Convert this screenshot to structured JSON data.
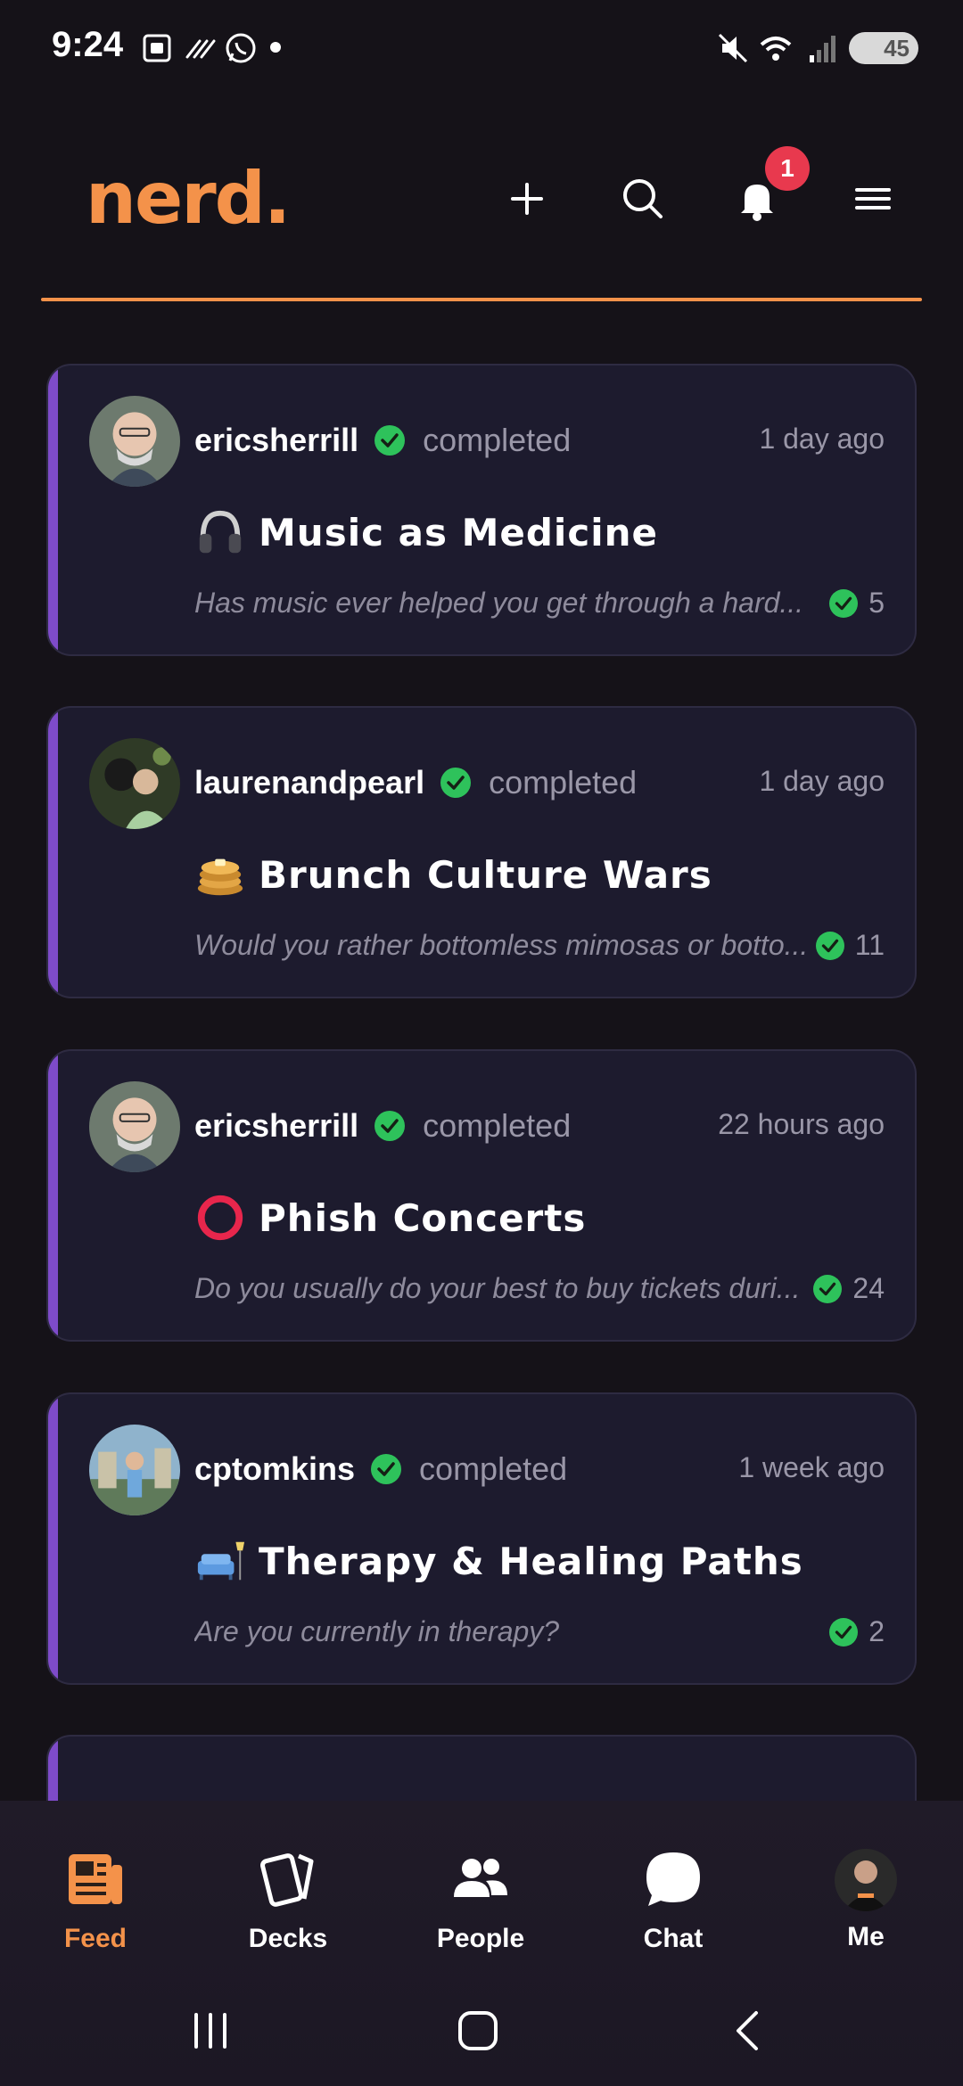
{
  "status_bar": {
    "time": "9:24",
    "battery": "45"
  },
  "header": {
    "logo": "nerd.",
    "notification_count": "1"
  },
  "feed": [
    {
      "user": "ericsherrill",
      "status": "completed",
      "time_ago": "1 day ago",
      "emoji": "headphones-icon",
      "title": "Music as Medicine",
      "desc": "Has music ever helped you get through a hard...",
      "count": "5"
    },
    {
      "user": "laurenandpearl",
      "status": "completed",
      "time_ago": "1 day ago",
      "emoji": "pancakes-icon",
      "title": "Brunch Culture Wars",
      "desc": "Would you rather bottomless mimosas or botto...",
      "count": "11"
    },
    {
      "user": "ericsherrill",
      "status": "completed",
      "time_ago": "22 hours ago",
      "emoji": "red-ring-icon",
      "title": "Phish Concerts",
      "desc": "Do you usually do your best to buy tickets duri...",
      "count": "24"
    },
    {
      "user": "cptomkins",
      "status": "completed",
      "time_ago": "1 week ago",
      "emoji": "couch-lamp-icon",
      "title": "Therapy & Healing Paths",
      "desc": "Are you currently in therapy?",
      "count": "2"
    }
  ],
  "nav": [
    {
      "label": "Feed",
      "icon": "feed-icon",
      "active": true
    },
    {
      "label": "Decks",
      "icon": "decks-icon"
    },
    {
      "label": "People",
      "icon": "people-icon"
    },
    {
      "label": "Chat",
      "icon": "chat-icon"
    },
    {
      "label": "Me",
      "icon": "avatar"
    }
  ],
  "colors": {
    "accent": "#f4924a",
    "card": "#1d1b2e",
    "card_accent": "#7e4bc9",
    "verified": "#2ec25b",
    "badge": "#e8394e"
  }
}
